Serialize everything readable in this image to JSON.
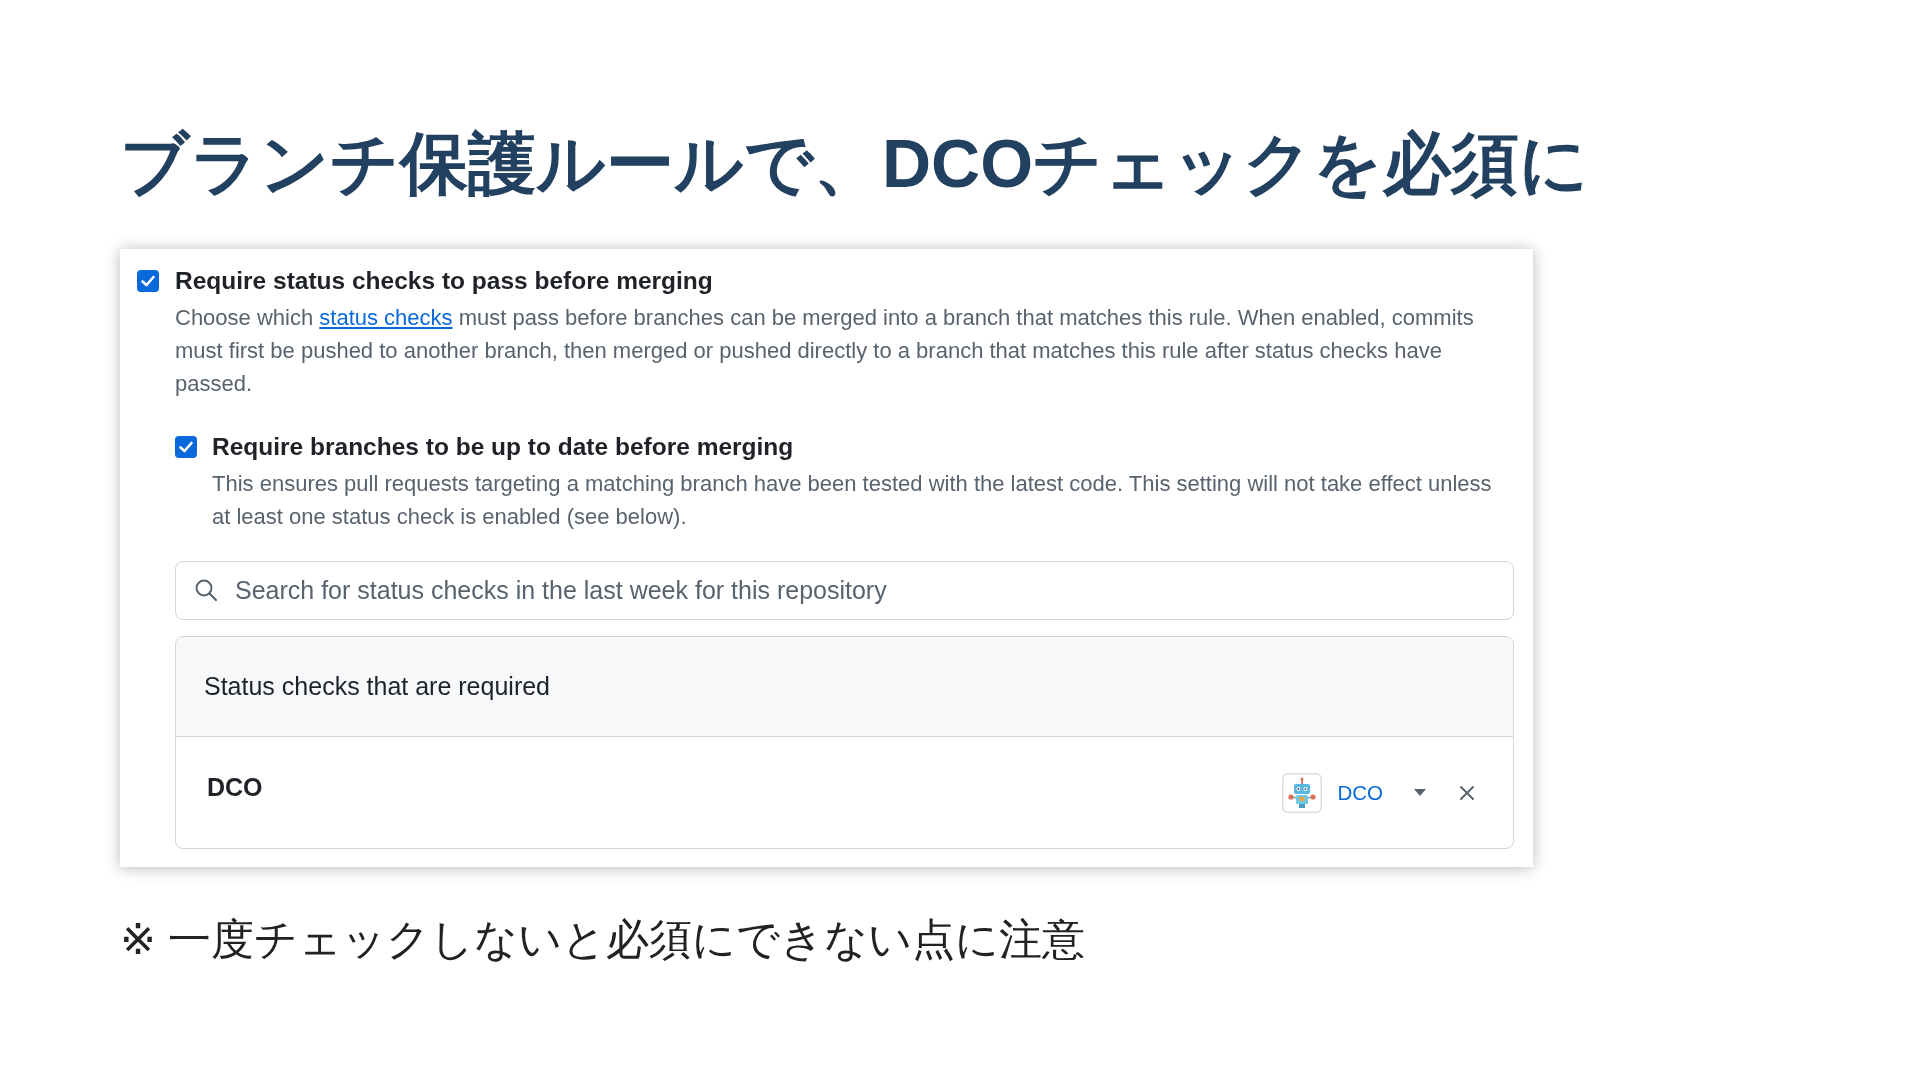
{
  "title": "ブランチ保護ルールで、DCOチェックを必須に",
  "rule": {
    "label": "Require status checks to pass before merging",
    "checked": true,
    "description": [
      {
        "kind": "text",
        "text": "Choose which "
      },
      {
        "kind": "link",
        "text": "status checks"
      },
      {
        "kind": "text",
        "text": " must pass before branches can be merged into a branch that matches this rule. When enabled, commits must first be pushed to another branch, then merged or pushed directly to a branch that matches this rule after status checks have passed."
      }
    ],
    "children": [
      {
        "label": "Require branches to be up to date before merging",
        "checked": true,
        "description": [
          {
            "kind": "text",
            "text": "This ensures pull requests targeting a matching branch have been tested with the latest code. This setting will not take effect unless at least one status check is enabled (see below)."
          }
        ]
      }
    ],
    "search": {
      "placeholder": "Search for status checks in the last week for this repository"
    },
    "required_checks": {
      "heading": "Status checks that are required",
      "rows": [
        {
          "name": "DCO",
          "app": "DCO"
        }
      ]
    }
  },
  "note": "※ 一度チェックしないと必須にできない点に注意"
}
